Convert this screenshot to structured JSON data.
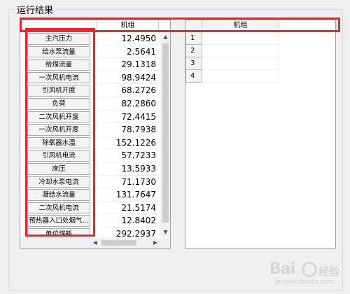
{
  "group": {
    "title": "运行结果"
  },
  "left_grid": {
    "column_header": "机组",
    "rows": [
      {
        "label": "主汽压力",
        "value": "12.4950"
      },
      {
        "label": "给水泵流量",
        "value": "2.5641"
      },
      {
        "label": "给煤流量",
        "value": "29.1318"
      },
      {
        "label": "一次风机电流",
        "value": "98.9424"
      },
      {
        "label": "引风机开度",
        "value": "68.2726"
      },
      {
        "label": "负荷",
        "value": "82.2860"
      },
      {
        "label": "二次风机开度",
        "value": "72.4415"
      },
      {
        "label": "一次风机开度",
        "value": "78.7938"
      },
      {
        "label": "除氧器水温",
        "value": "152.1226"
      },
      {
        "label": "引风机电流",
        "value": "57.7233"
      },
      {
        "label": "床压",
        "value": "13.5933"
      },
      {
        "label": "冷却水泵电流",
        "value": "71.1730"
      },
      {
        "label": "凝结水流量",
        "value": "131.7647"
      },
      {
        "label": "二次风机电流",
        "value": "21.5174"
      },
      {
        "label": "预热器入口处烟气...",
        "value": "12.8402"
      },
      {
        "label": "单位煤耗",
        "value": "292.2937"
      }
    ]
  },
  "right_grid": {
    "column_header": "机组",
    "rows": [
      {
        "num": "1"
      },
      {
        "num": "2"
      },
      {
        "num": "3"
      },
      {
        "num": "4"
      }
    ]
  },
  "watermark": {
    "logo": "Bai",
    "logo2": "经验",
    "url": "jingyan.baidu.com"
  },
  "colors": {
    "highlight": "#e8262d",
    "background": "#f0f0f0"
  }
}
